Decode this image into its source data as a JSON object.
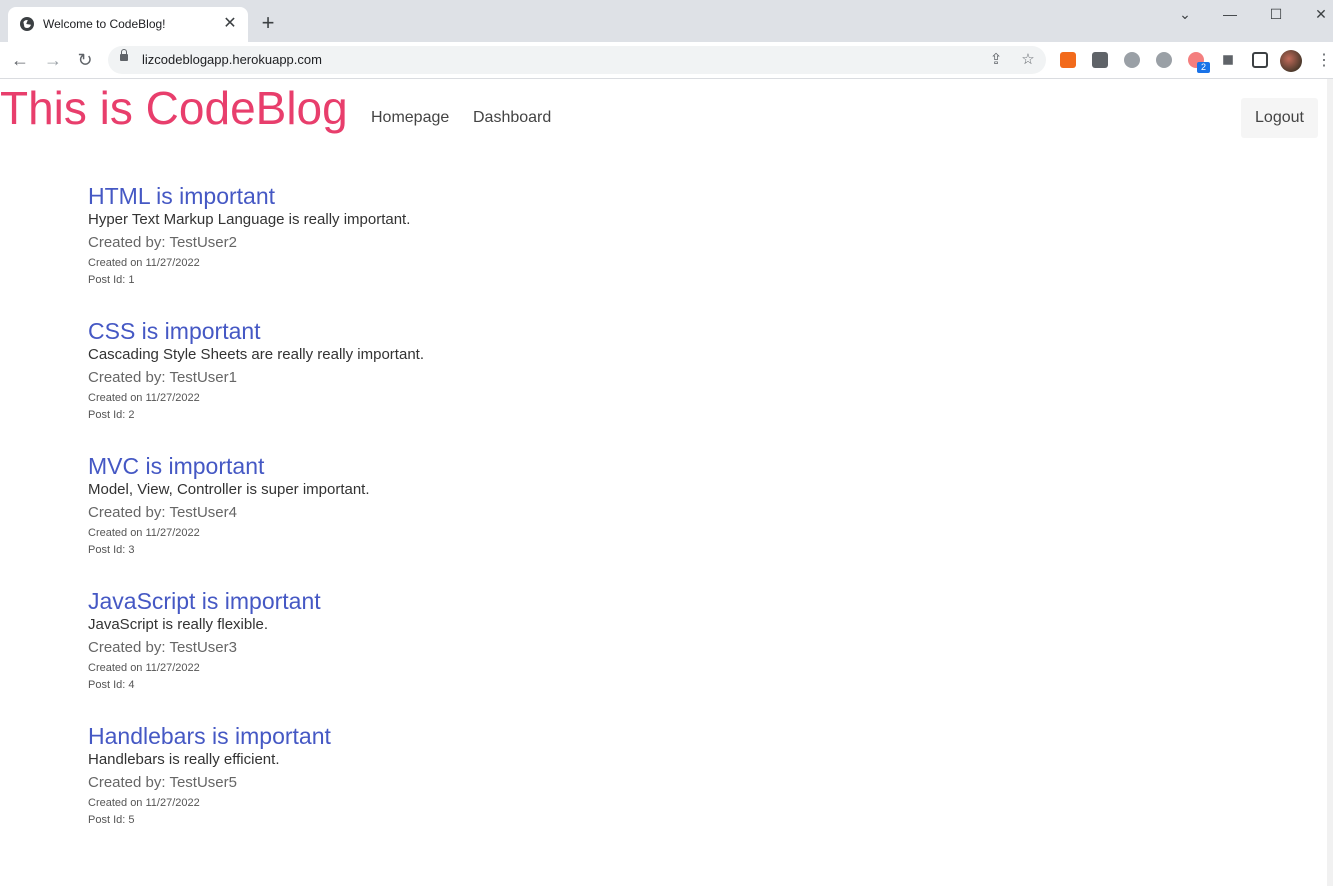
{
  "browser": {
    "tab_title": "Welcome to CodeBlog!",
    "url": "lizcodeblogapp.herokuapp.com",
    "extension_badge": "2"
  },
  "header": {
    "title": "This is CodeBlog",
    "nav": [
      "Homepage",
      "Dashboard"
    ],
    "logout_label": "Logout"
  },
  "posts": [
    {
      "title": "HTML is important",
      "body": "Hyper Text Markup Language is really important.",
      "author": "Created by: TestUser2",
      "date": "Created on 11/27/2022",
      "id": "Post Id: 1"
    },
    {
      "title": "CSS is important",
      "body": "Cascading Style Sheets are really really important.",
      "author": "Created by: TestUser1",
      "date": "Created on 11/27/2022",
      "id": "Post Id: 2"
    },
    {
      "title": "MVC is important",
      "body": "Model, View, Controller is super important.",
      "author": "Created by: TestUser4",
      "date": "Created on 11/27/2022",
      "id": "Post Id: 3"
    },
    {
      "title": "JavaScript is important",
      "body": "JavaScript is really flexible.",
      "author": "Created by: TestUser3",
      "date": "Created on 11/27/2022",
      "id": "Post Id: 4"
    },
    {
      "title": "Handlebars is important",
      "body": "Handlebars is really efficient.",
      "author": "Created by: TestUser5",
      "date": "Created on 11/27/2022",
      "id": "Post Id: 5"
    }
  ],
  "colors": {
    "site_title": "#e83e6c",
    "post_title": "#4558c4"
  }
}
